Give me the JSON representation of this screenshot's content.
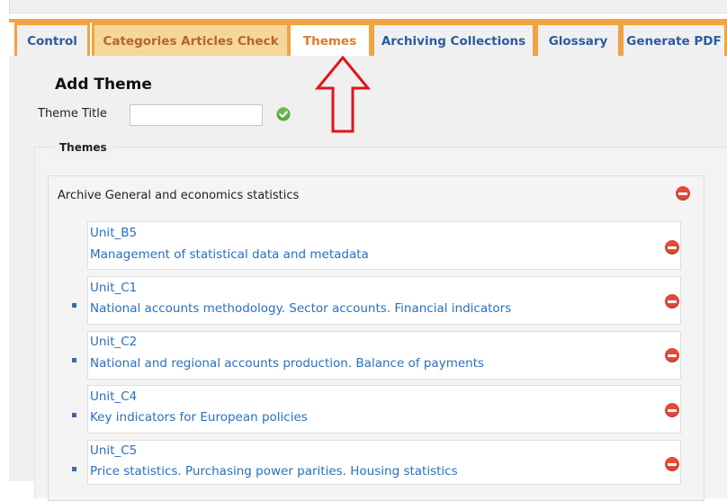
{
  "tabs": [
    {
      "label": "Control"
    },
    {
      "label": "Categories Articles Check"
    },
    {
      "label": "Themes"
    },
    {
      "label": "Archiving Collections"
    },
    {
      "label": "Glossary"
    },
    {
      "label": "Generate PDF"
    }
  ],
  "active_tab": "Themes",
  "form": {
    "heading": "Add Theme",
    "field_label": "Theme Title",
    "field_value": ""
  },
  "themes": {
    "legend": "Themes",
    "group_title": "Archive General and economics statistics",
    "units": [
      {
        "code": "Unit_B5",
        "description": "Management of statistical data and metadata"
      },
      {
        "code": "Unit_C1",
        "description": "National accounts methodology. Sector accounts. Financial indicators"
      },
      {
        "code": "Unit_C2",
        "description": "National and regional accounts production. Balance of payments"
      },
      {
        "code": "Unit_C4",
        "description": "Key indicators for European policies"
      },
      {
        "code": "Unit_C5",
        "description": "Price statistics. Purchasing power parities. Housing statistics"
      }
    ]
  },
  "colors": {
    "tab_border": "#f2a341",
    "link": "#2a6fbf",
    "remove": "#e34a3a",
    "confirm": "#5aa83a",
    "annotation_arrow": "#e0151b"
  }
}
